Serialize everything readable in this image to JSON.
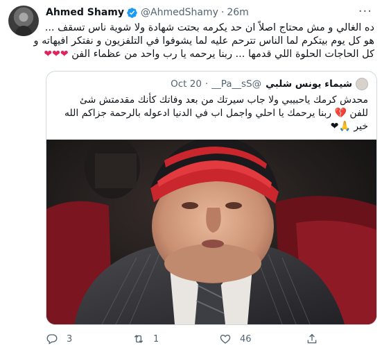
{
  "author": {
    "name": "Ahmed Shamy",
    "handle": "@AhmedShamy",
    "time": "26m",
    "separator": "·"
  },
  "tweet": {
    "lines": [
      "ده الغالي و مش محتاج اصلاً ان حد يكرمه بحتت شهادة ولا شوية ناس تسقف ...",
      "هو كل يوم بيتكرم لما الناس تترحم عليه لما يشوفوا في التلفزيون و نفتكر افيهاته و",
      "كل الحاجات الحلوة اللي قدمها ... ربنا يرحمه يا رب واحد من عظماء الفن"
    ],
    "hearts": "❤❤❤"
  },
  "quoted": {
    "name": "شيماء يونس شلبي",
    "handle": "@Pa__sS__",
    "separator": "·",
    "time": "Oct 20",
    "lines": [
      "محدش كرمك ياحبيبي ولا جاب سيرتك من بعد وفاتك كأنك مقدمتش شئ",
      "للفن 💔 ربنا يرحمك يا احلي واجمل اب في الدنيا ادعوله بالرحمة جزاكم الله",
      "خير 🙏❤"
    ]
  },
  "actions": {
    "replies": "3",
    "retweets": "1",
    "likes": "46"
  },
  "colors": {
    "text": "#0f1419",
    "secondary": "#536471",
    "verified": "#1d9bf0",
    "heart": "#e0245e",
    "border": "#cfd9de"
  }
}
